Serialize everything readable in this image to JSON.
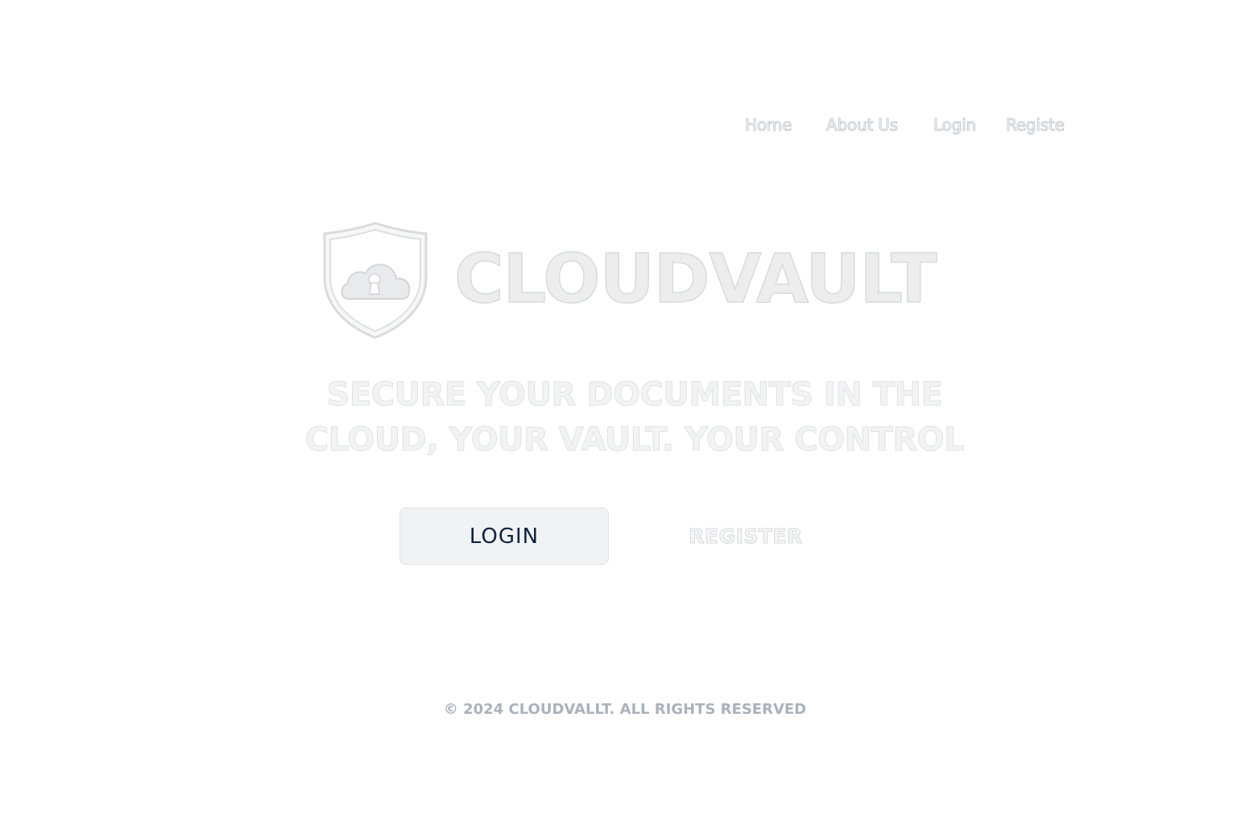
{
  "nav": {
    "items": [
      {
        "label": "Home"
      },
      {
        "label": "About Us"
      },
      {
        "label": "Login"
      },
      {
        "label": "Registe"
      }
    ]
  },
  "brand": {
    "name": "CLOUDVAULT",
    "logo_icon": "shield-cloud-lock-icon"
  },
  "hero": {
    "tagline_line1": "SECURE YOUR DOCUMENTS IN THE",
    "tagline_line2": "CLOUD, YOUR VAULT. YOUR CONTROL"
  },
  "actions": {
    "login_label": "LOGIN",
    "register_label": "REGISTER"
  },
  "footer": {
    "text": "© 2024 CLOUDVALLT. ALL RIGHTS RESERVED"
  },
  "colors": {
    "background": "#ffffff",
    "login_text": "#0f2340",
    "login_bg": "#f0f2f4",
    "muted_text": "#aab2bb"
  }
}
